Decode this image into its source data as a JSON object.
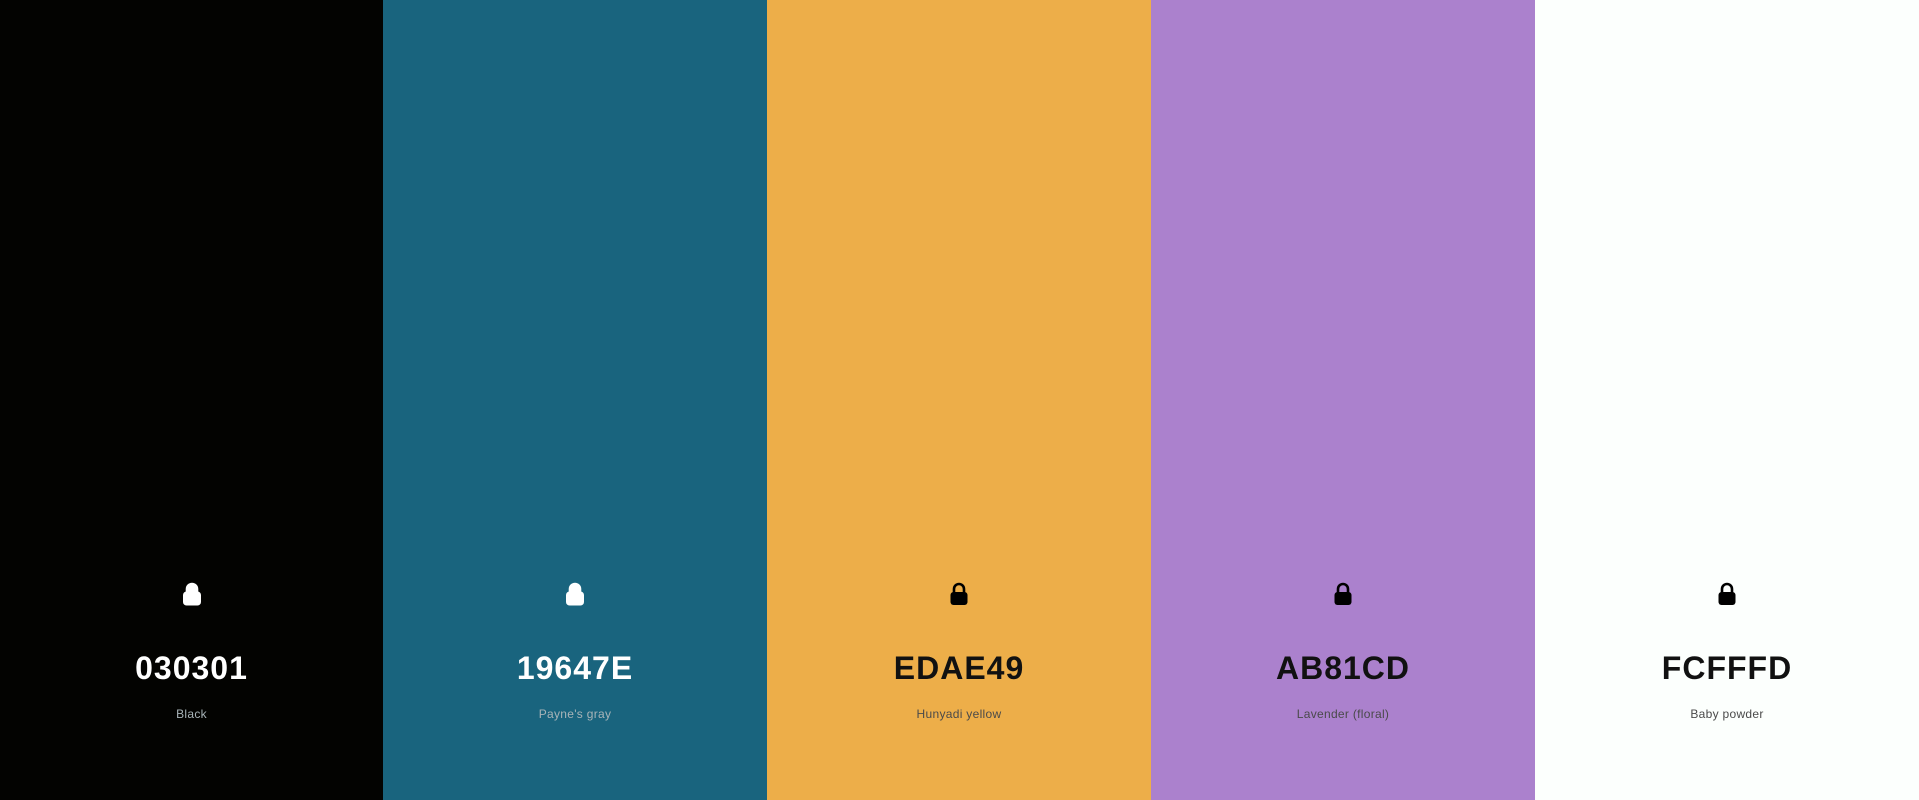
{
  "swatches": [
    {
      "hex": "030301",
      "name": "Black",
      "color": "#030301",
      "text_theme": "light",
      "icon": "lock-icon"
    },
    {
      "hex": "19647E",
      "name": "Payne's gray",
      "color": "#19647E",
      "text_theme": "light",
      "icon": "lock-icon"
    },
    {
      "hex": "EDAE49",
      "name": "Hunyadi yellow",
      "color": "#EDAE49",
      "text_theme": "dark",
      "icon": "lock-icon"
    },
    {
      "hex": "AB81CD",
      "name": "Lavender (floral)",
      "color": "#AB81CD",
      "text_theme": "dark",
      "icon": "lock-icon"
    },
    {
      "hex": "FCFFFD",
      "name": "Baby powder",
      "color": "#FCFFFD",
      "text_theme": "dark",
      "icon": "lock-icon"
    }
  ]
}
